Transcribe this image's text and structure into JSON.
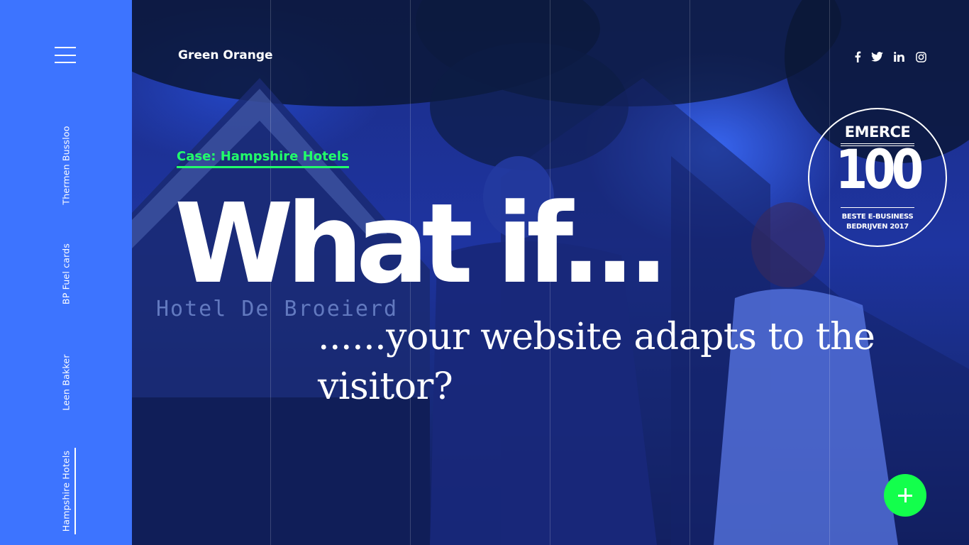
{
  "sidebar": {
    "menu_icon": "hamburger-menu-icon",
    "items": [
      {
        "label": "Thermen Bussloo",
        "active": false
      },
      {
        "label": "BP Fuel cards",
        "active": false
      },
      {
        "label": "Leen Bakker",
        "active": false
      },
      {
        "label": "Hampshire Hotels",
        "active": true
      }
    ]
  },
  "header": {
    "brand": "Green Orange",
    "social": [
      "facebook-icon",
      "twitter-icon",
      "linkedin-icon",
      "instagram-icon"
    ]
  },
  "badge": {
    "top": "EMERCE",
    "number": "100",
    "line1": "BESTE E-BUSINESS",
    "line2": "BEDRIJVEN 2017"
  },
  "hero": {
    "case_link": "Case: Hampshire Hotels",
    "headline": "What if...",
    "subline": "......your website adapts to the visitor?",
    "sign_text": "Hotel De Broeierd"
  },
  "fab": {
    "icon": "plus-icon"
  },
  "colors": {
    "sidebar": "#3d74ff",
    "accent_green": "#22ff6a",
    "fab": "#13ff4c",
    "hero_tint": "#1e34a0"
  }
}
